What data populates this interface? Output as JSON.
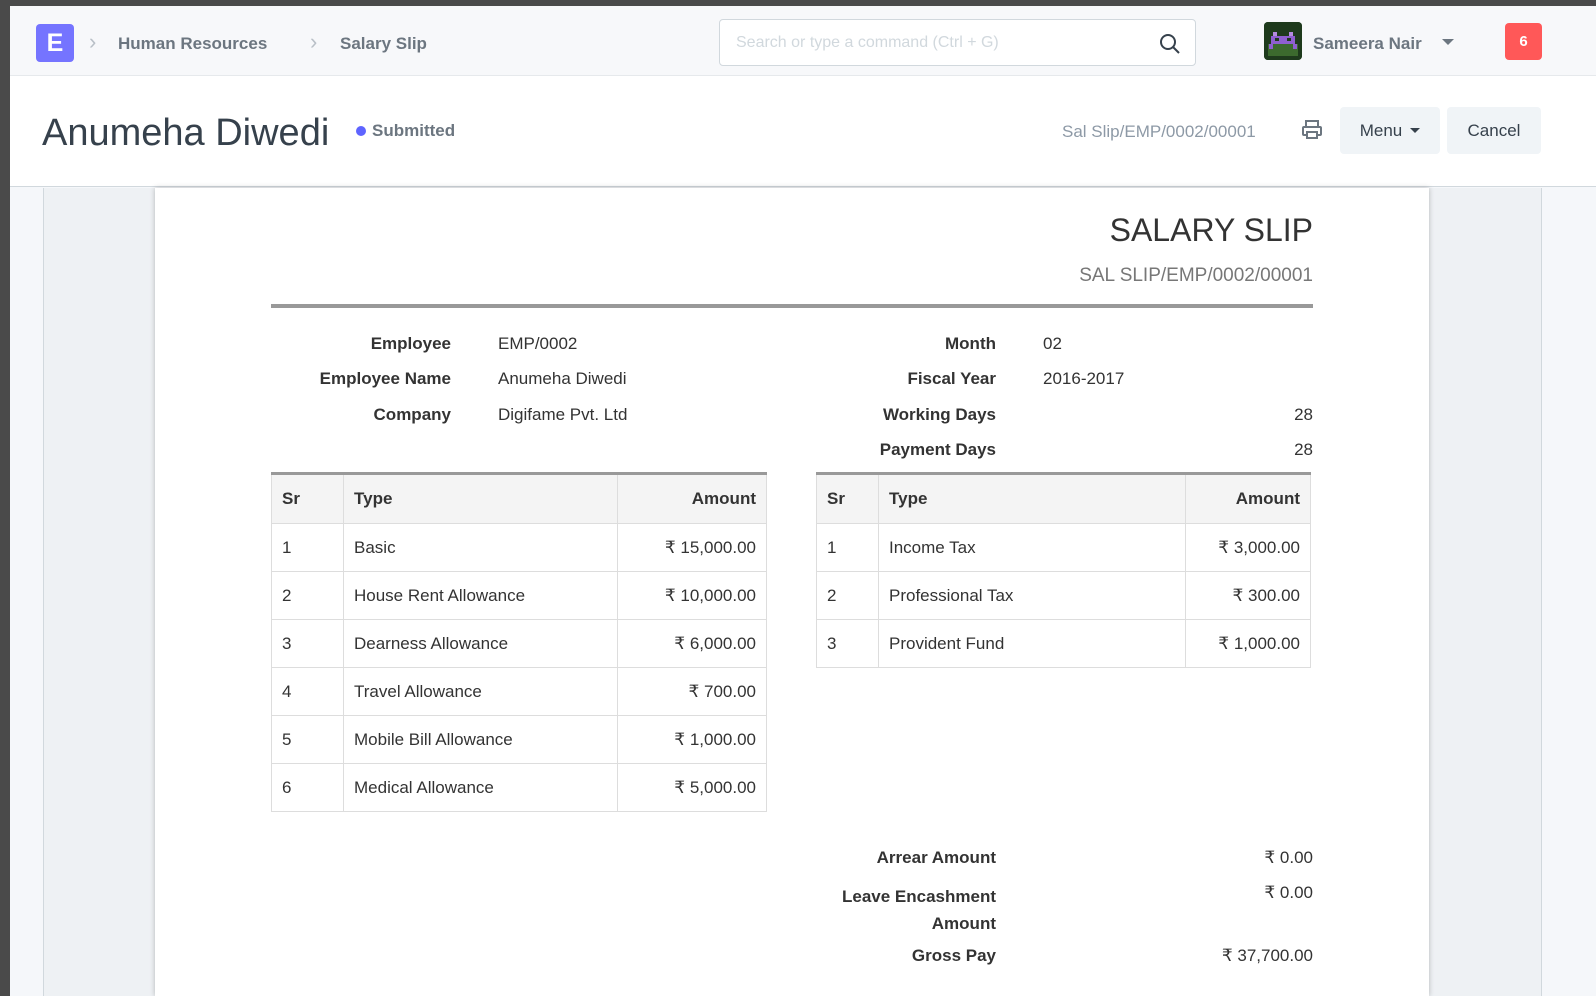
{
  "navbar": {
    "logo_letter": "E",
    "breadcrumbs": [
      "Human Resources",
      "Salary Slip"
    ],
    "search_placeholder": "Search or type a command (Ctrl + G)",
    "user_name": "Sameera Nair",
    "notification_count": "6"
  },
  "page_head": {
    "title": "Anumeha Diwedi",
    "status": "Submitted",
    "doc_id": "Sal Slip/EMP/0002/00001",
    "menu_label": "Menu",
    "cancel_label": "Cancel"
  },
  "slip": {
    "title": "SALARY SLIP",
    "subtitle": "SAL SLIP/EMP/0002/00001",
    "left_fields": [
      {
        "label": "Employee",
        "value": "EMP/0002"
      },
      {
        "label": "Employee Name",
        "value": "Anumeha Diwedi"
      },
      {
        "label": "Company",
        "value": "Digifame Pvt. Ltd"
      }
    ],
    "right_fields": [
      {
        "label": "Month",
        "value": "02"
      },
      {
        "label": "Fiscal Year",
        "value": "2016-2017"
      },
      {
        "label": "Working Days",
        "value": "28"
      },
      {
        "label": "Payment Days",
        "value": "28"
      }
    ],
    "earnings": {
      "headers": [
        "Sr",
        "Type",
        "Amount"
      ],
      "rows": [
        [
          "1",
          "Basic",
          "₹ 15,000.00"
        ],
        [
          "2",
          "House Rent Allowance",
          "₹ 10,000.00"
        ],
        [
          "3",
          "Dearness Allowance",
          "₹ 6,000.00"
        ],
        [
          "4",
          "Travel Allowance",
          "₹ 700.00"
        ],
        [
          "5",
          "Mobile Bill Allowance",
          "₹ 1,000.00"
        ],
        [
          "6",
          "Medical Allowance",
          "₹ 5,000.00"
        ]
      ]
    },
    "deductions": {
      "headers": [
        "Sr",
        "Type",
        "Amount"
      ],
      "rows": [
        [
          "1",
          "Income Tax",
          "₹ 3,000.00"
        ],
        [
          "2",
          "Professional Tax",
          "₹ 300.00"
        ],
        [
          "3",
          "Provident Fund",
          "₹ 1,000.00"
        ]
      ]
    },
    "totals": [
      {
        "label": "Arrear Amount",
        "value": "₹ 0.00"
      },
      {
        "label": "Leave Encashment Amount",
        "value": "₹ 0.00"
      },
      {
        "label": "Gross Pay",
        "value": "₹ 37,700.00"
      }
    ]
  },
  "colors": {
    "brand": "#7574ff",
    "status_dot": "#5e64ff",
    "notification": "#ff5858"
  }
}
